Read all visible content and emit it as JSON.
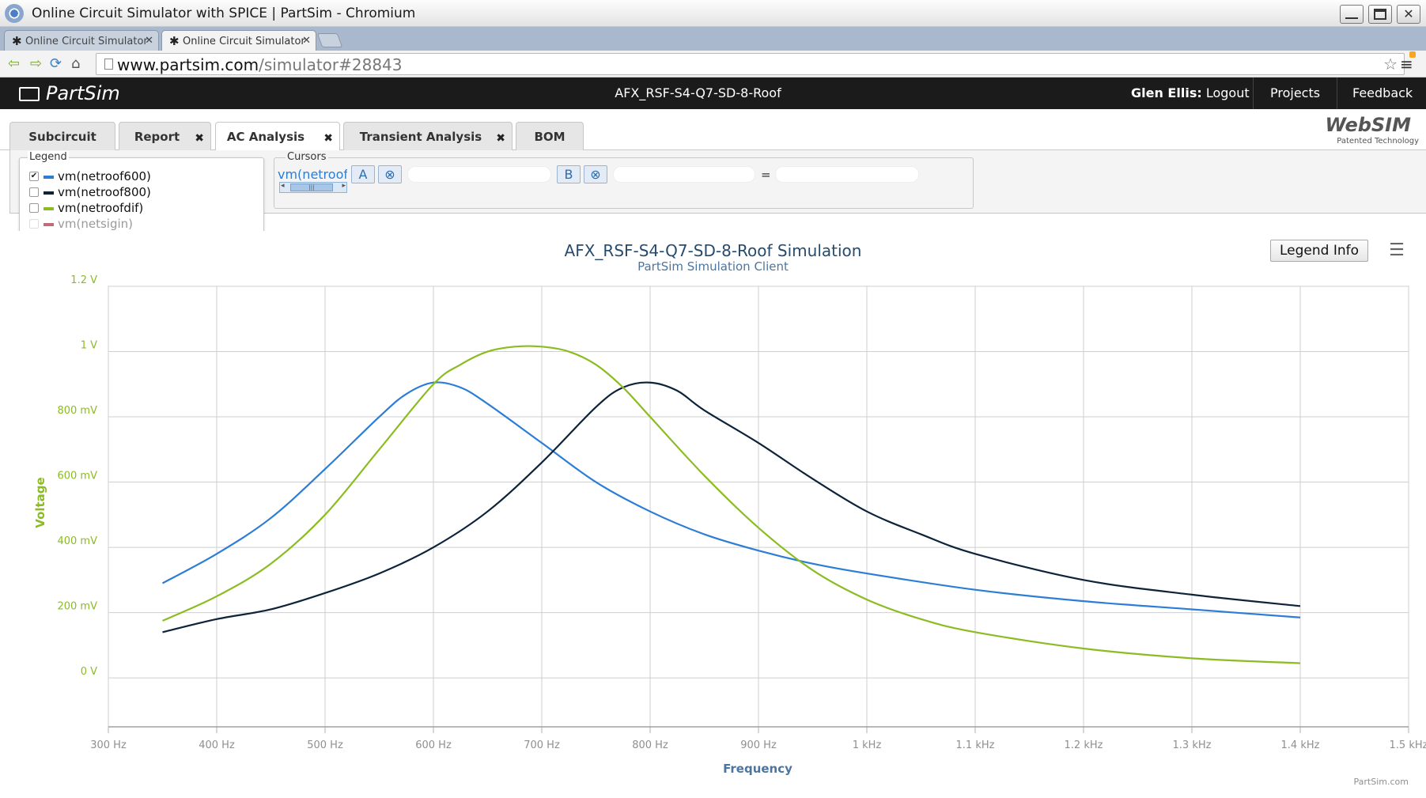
{
  "browser": {
    "window_title": "Online Circuit Simulator with SPICE | PartSim - Chromium",
    "tabs": [
      {
        "label": "Online Circuit Simulator"
      },
      {
        "label": "Online Circuit Simulator"
      }
    ],
    "url_host": "www.partsim.com",
    "url_path": "/simulator#28843"
  },
  "header": {
    "logo": "PartSim",
    "project_name": "AFX_RSF-S4-Q7-SD-8-Roof",
    "user_name": "Glen Ellis:",
    "logout": "Logout",
    "projects": "Projects",
    "feedback": "Feedback"
  },
  "tabs": [
    {
      "label": "Subcircuit"
    },
    {
      "label": "Report"
    },
    {
      "label": "AC Analysis"
    },
    {
      "label": "Transient Analysis"
    },
    {
      "label": "BOM"
    }
  ],
  "websim": {
    "word": "WebSIM",
    "sub": "Patented Technology"
  },
  "legend_panel": {
    "title": "Legend",
    "items": [
      {
        "label": "vm(netroof600)",
        "checked": true,
        "color": "#2b7dd6"
      },
      {
        "label": "vm(netroof800)",
        "checked": false,
        "color": "#0d233a"
      },
      {
        "label": "vm(netroofdif)",
        "checked": false,
        "color": "#8bbc21"
      },
      {
        "label": "vm(netsigin)",
        "checked": false,
        "color": "#c46a75"
      }
    ]
  },
  "cursors": {
    "title": "Cursors",
    "series": "vm(netroof",
    "a_label": "A",
    "b_label": "B",
    "clear_symbol": "⊗",
    "equals": "="
  },
  "chart": {
    "legend_info_label": "Legend Info",
    "credit": "PartSim.com"
  },
  "chart_data": {
    "type": "line",
    "title": "AFX_RSF-S4-Q7-SD-8-Roof Simulation",
    "subtitle": "PartSim Simulation Client",
    "xlabel": "Frequency",
    "ylabel": "Voltage",
    "xlim": [
      300,
      1500
    ],
    "ylim": [
      -0.15,
      1.2
    ],
    "x_ticks": [
      {
        "v": 300,
        "label": "300 Hz"
      },
      {
        "v": 400,
        "label": "400 Hz"
      },
      {
        "v": 500,
        "label": "500 Hz"
      },
      {
        "v": 600,
        "label": "600 Hz"
      },
      {
        "v": 700,
        "label": "700 Hz"
      },
      {
        "v": 800,
        "label": "800 Hz"
      },
      {
        "v": 900,
        "label": "900 Hz"
      },
      {
        "v": 1000,
        "label": "1 kHz"
      },
      {
        "v": 1100,
        "label": "1.1 kHz"
      },
      {
        "v": 1200,
        "label": "1.2 kHz"
      },
      {
        "v": 1300,
        "label": "1.3 kHz"
      },
      {
        "v": 1400,
        "label": "1.4 kHz"
      },
      {
        "v": 1500,
        "label": "1.5 kHz"
      }
    ],
    "y_ticks": [
      {
        "v": 0,
        "label": "0 V"
      },
      {
        "v": 0.2,
        "label": "200 mV"
      },
      {
        "v": 0.4,
        "label": "400 mV"
      },
      {
        "v": 0.6,
        "label": "600 mV"
      },
      {
        "v": 0.8,
        "label": "800 mV"
      },
      {
        "v": 1.0,
        "label": "1 V"
      },
      {
        "v": 1.2,
        "label": "1.2 V"
      }
    ],
    "grid": true,
    "series": [
      {
        "name": "vm(netroof600)",
        "color": "#2b7dd6",
        "x": [
          350,
          400,
          450,
          500,
          550,
          575,
          600,
          625,
          650,
          700,
          750,
          800,
          850,
          900,
          950,
          1000,
          1100,
          1200,
          1300,
          1400
        ],
        "values": [
          0.29,
          0.38,
          0.49,
          0.64,
          0.8,
          0.87,
          0.905,
          0.89,
          0.84,
          0.72,
          0.6,
          0.51,
          0.44,
          0.39,
          0.35,
          0.32,
          0.27,
          0.235,
          0.21,
          0.185
        ]
      },
      {
        "name": "vm(netroof800)",
        "color": "#0d233a",
        "x": [
          350,
          400,
          450,
          500,
          550,
          600,
          650,
          700,
          750,
          775,
          800,
          825,
          850,
          900,
          950,
          1000,
          1050,
          1100,
          1200,
          1300,
          1400
        ],
        "values": [
          0.14,
          0.18,
          0.21,
          0.26,
          0.32,
          0.4,
          0.51,
          0.66,
          0.83,
          0.89,
          0.905,
          0.88,
          0.82,
          0.72,
          0.61,
          0.51,
          0.44,
          0.38,
          0.3,
          0.255,
          0.22
        ]
      },
      {
        "name": "vm(netroofdif)",
        "color": "#8bbc21",
        "x": [
          350,
          400,
          450,
          500,
          550,
          600,
          625,
          650,
          675,
          700,
          725,
          750,
          775,
          800,
          850,
          900,
          950,
          1000,
          1050,
          1100,
          1200,
          1300,
          1400
        ],
        "values": [
          0.175,
          0.25,
          0.35,
          0.5,
          0.7,
          0.9,
          0.96,
          1.0,
          1.015,
          1.015,
          1.0,
          0.96,
          0.89,
          0.8,
          0.62,
          0.46,
          0.33,
          0.24,
          0.18,
          0.14,
          0.09,
          0.06,
          0.045
        ]
      }
    ]
  }
}
